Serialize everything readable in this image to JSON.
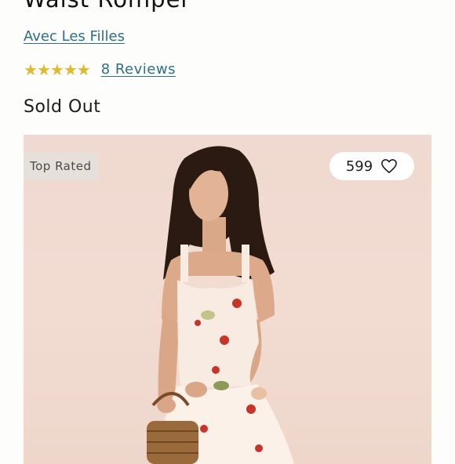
{
  "product": {
    "title": "Waist Romper",
    "brand": "Avec Les Filles",
    "rating_stars": 5,
    "reviews_label": "8 Reviews",
    "status": "Sold Out"
  },
  "image_overlay": {
    "badge": "Top Rated",
    "like_count": "599"
  },
  "icons": {
    "star": "star-icon",
    "heart": "heart-outline-icon"
  },
  "colors": {
    "link": "#2d6f8a",
    "star": "#e2b92d",
    "background": "#fdfdfb"
  }
}
